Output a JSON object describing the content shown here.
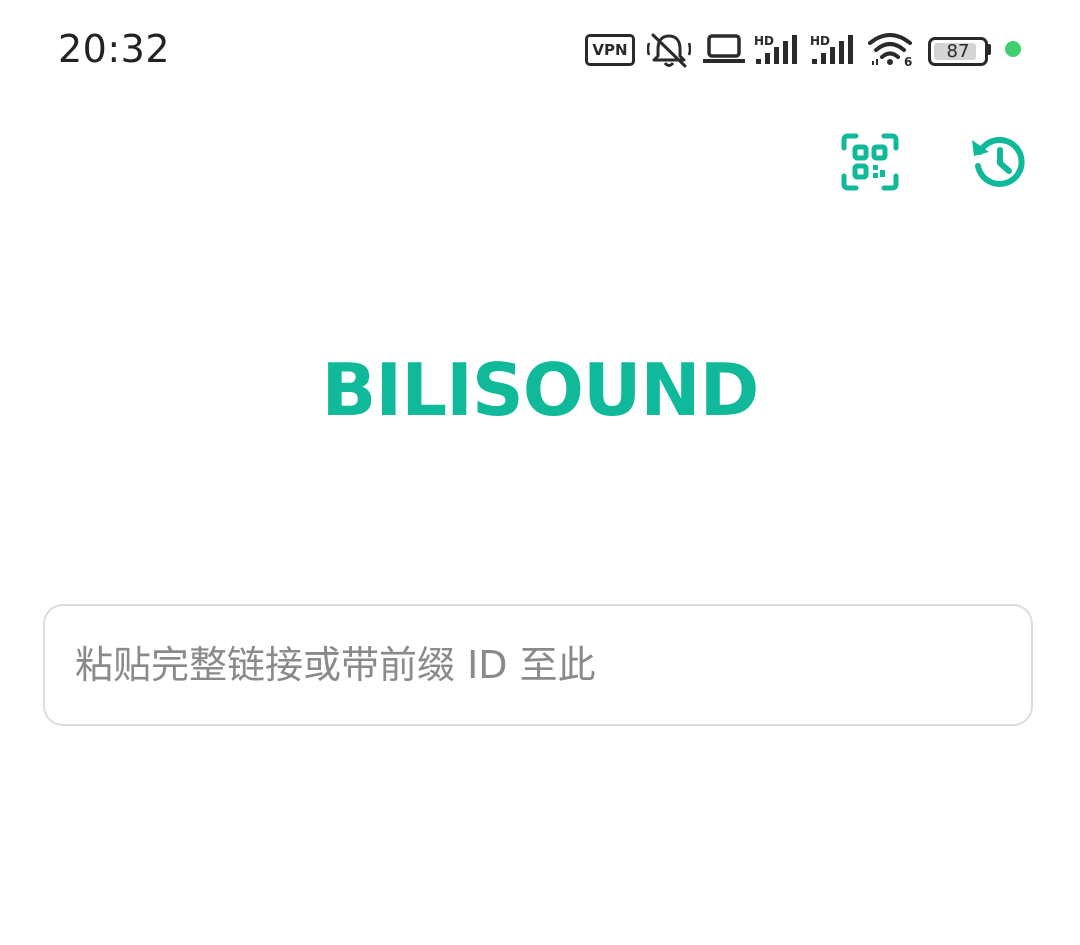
{
  "status_bar": {
    "time": "20:32",
    "vpn_label": "VPN",
    "signal_1_label": "HD",
    "signal_2_label": "HD",
    "wifi_label": "6",
    "battery_percent": 87,
    "battery_text": "87",
    "icons": [
      "vpn-icon",
      "muted-bell-icon",
      "laptop-icon",
      "signal-hd-icon",
      "signal-hd-icon",
      "wifi-icon",
      "battery-icon",
      "active-dot-icon"
    ],
    "dot_color": "#3ecf6e"
  },
  "toolbar": {
    "qr_icon": "qr-scan-icon",
    "history_icon": "history-icon"
  },
  "main": {
    "title": "BILISOUND",
    "input_placeholder": "粘贴完整链接或带前缀 ID 至此",
    "input_value": ""
  },
  "colors": {
    "accent": "#0fb99a",
    "text_dark": "#222222",
    "placeholder": "#8a8a8a",
    "border": "#dcdcdc"
  }
}
